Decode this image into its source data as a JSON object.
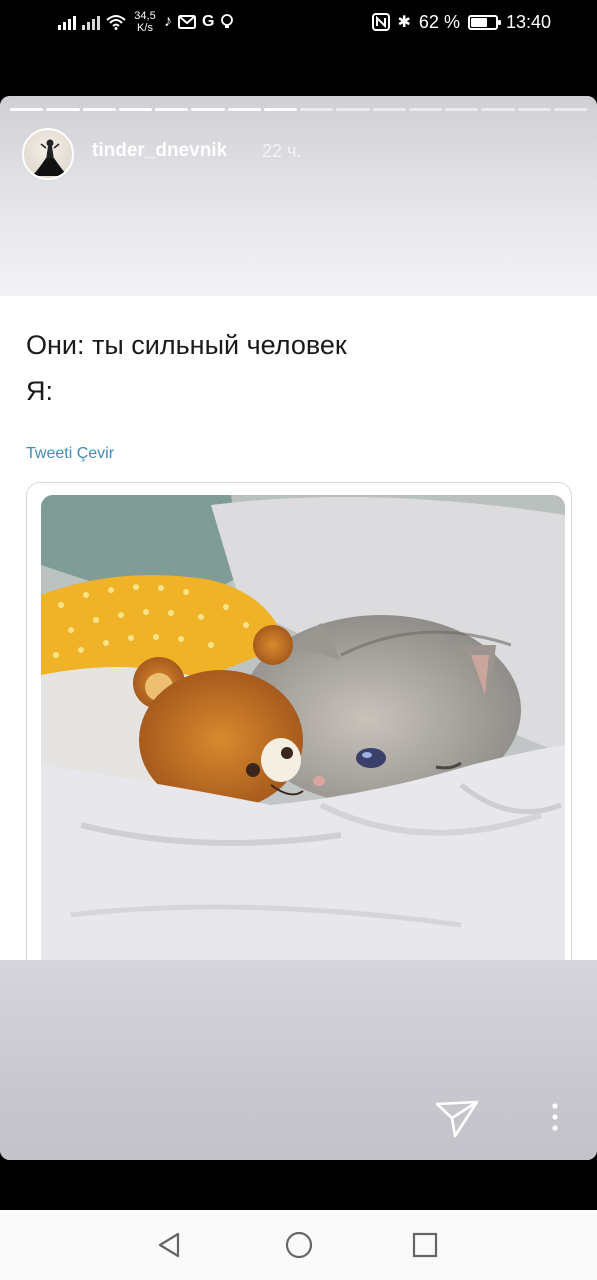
{
  "status_bar": {
    "speed_value": "34,5",
    "speed_unit": "K/s",
    "battery_percent_text": "62 %",
    "battery_level": 0.62,
    "time": "13:40",
    "icons": [
      "signal-icon",
      "signal-off-icon",
      "wifi-icon",
      "tiktok-icon",
      "gmail-icon",
      "google-icon",
      "bulb-icon",
      "nfc-icon",
      "bluetooth-icon",
      "battery-icon"
    ]
  },
  "story": {
    "progress_total": 16,
    "progress_done": 8,
    "username": "tinder_dnevnik",
    "time_ago": "22 ч.",
    "tweet_lines": [
      "Они: ты сильный человек",
      "Я:"
    ],
    "translate_link": "Tweeti Çevir",
    "photo_description_icon": "cat-with-teddy-bear-image"
  },
  "story_actions": {
    "send_icon": "send-icon",
    "more_icon": "more-vertical-icon"
  },
  "navbar": {
    "icons": [
      "back-triangle-icon",
      "home-circle-icon",
      "recents-square-icon"
    ]
  }
}
